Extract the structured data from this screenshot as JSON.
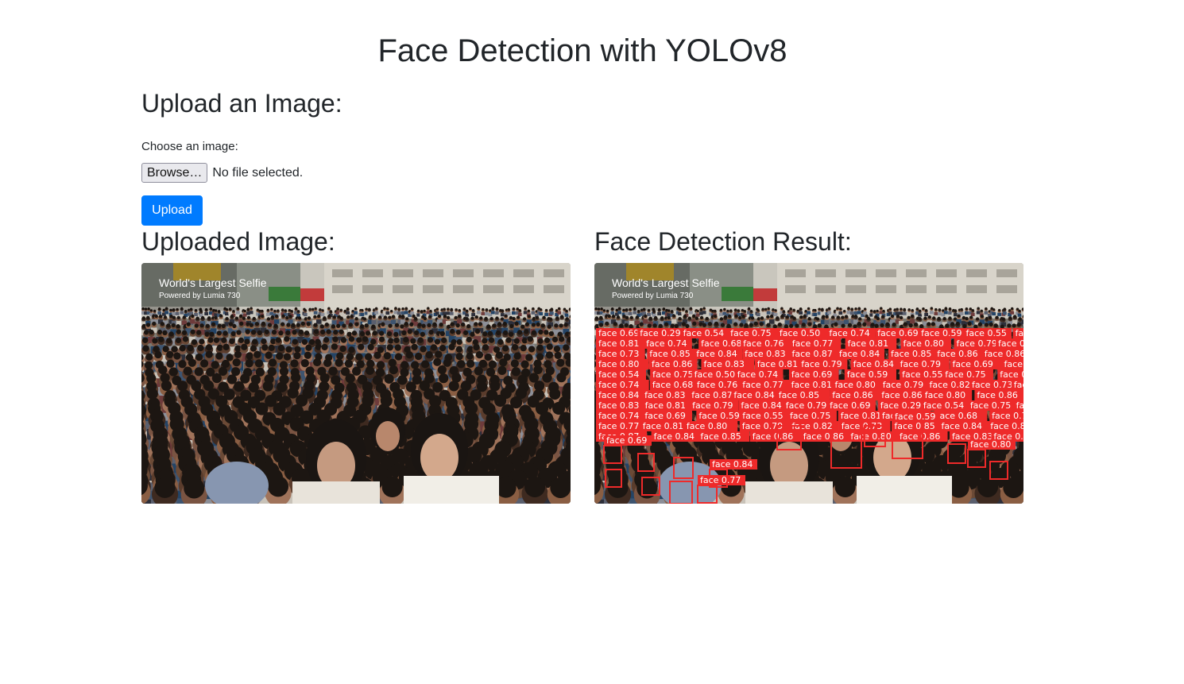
{
  "page": {
    "title": "Face Detection with YOLOv8"
  },
  "upload_form": {
    "heading": "Upload an Image:",
    "choose_label": "Choose an image:",
    "browse_label": "Browse…",
    "file_status": "No file selected.",
    "submit_label": "Upload"
  },
  "uploaded": {
    "heading": "Uploaded Image:",
    "watermark_title": "World's Largest Selfie",
    "watermark_sub": "Powered by Lumia 730"
  },
  "result": {
    "heading": "Face Detection Result:",
    "watermark_title": "World's Largest Selfie",
    "watermark_sub": "Powered by Lumia 730",
    "box_color": "#ee2a2a",
    "detection_labels": [
      "face 0.69",
      "face 0.29",
      "face 0.54",
      "face 0.75",
      "face 0.50",
      "face 0.74",
      "face 0.69",
      "face 0.59",
      "face 0.55",
      "face 0.75",
      "face 0.81",
      "face 0.74",
      "face 0.68",
      "face 0.76",
      "face 0.77",
      "face 0.81",
      "face 0.80",
      "face 0.79",
      "face 0.82",
      "face 0.73",
      "face 0.85",
      "face 0.84",
      "face 0.83",
      "face 0.87",
      "face 0.84",
      "face 0.85",
      "face 0.86",
      "face 0.86",
      "face 0.80",
      "face 0.86",
      "face 0.83",
      "face 0.81",
      "face 0.79",
      "face 0.84",
      "face 0.79"
    ]
  }
}
